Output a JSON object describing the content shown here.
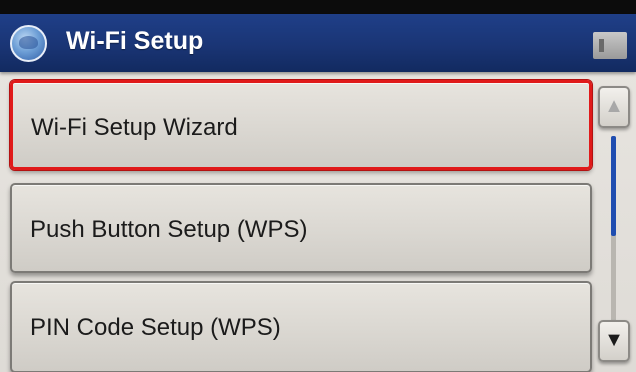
{
  "header": {
    "title": "Wi-Fi Setup",
    "home_icon": "home-icon",
    "status_icon": "status-icon"
  },
  "menu": {
    "items": [
      {
        "label": "Wi-Fi Setup Wizard",
        "selected": true
      },
      {
        "label": "Push Button Setup (WPS)",
        "selected": false
      },
      {
        "label": "PIN Code Setup (WPS)",
        "selected": false
      }
    ]
  },
  "scroll": {
    "up_glyph": "▲",
    "down_glyph": "▼",
    "position_fraction": 0.0
  },
  "colors": {
    "header_bg": "#1a3575",
    "selection_border": "#e01a1a",
    "scroll_thumb": "#1f4db0"
  }
}
